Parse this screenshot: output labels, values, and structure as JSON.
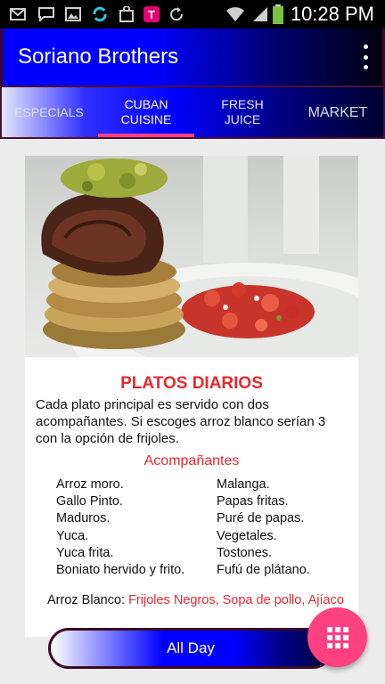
{
  "status_bar": {
    "icons": [
      "mail-icon",
      "chat-icon",
      "image-icon",
      "sync-app-icon",
      "bag-icon",
      "tmobile-icon",
      "refresh-icon",
      "wifi-icon",
      "signal-icon",
      "battery-icon"
    ],
    "time": "10:28 PM"
  },
  "app_bar": {
    "title": "Soriano Brothers",
    "menu_icon": "more-vert-icon"
  },
  "tabs": [
    {
      "label": "ESPECIALS",
      "selected": false
    },
    {
      "label": "CUBAN CUISINE",
      "selected": true
    },
    {
      "label": "FRESH JUICE",
      "selected": false
    },
    {
      "label": "MARKET",
      "selected": false
    }
  ],
  "colors": {
    "accent": "#ff4081",
    "heading_red": "#e8282f",
    "primary_blue": "#0000ff"
  },
  "card": {
    "title": "PLATOS DIARIOS",
    "description": "Cada plato principal es servido con dos acompañantes. Si escoges arroz blanco serían 3 con la opción de frijoles.",
    "sides_title": "Acompañantes",
    "sides_left": [
      "Arroz moro.",
      "Gallo Pinto.",
      "Maduros.",
      "Yuca.",
      "Yuca frita.",
      "Boniato hervido y frito."
    ],
    "sides_right": [
      "Malanga.",
      "Papas fritas.",
      "Puré de papas.",
      "Vegetales.",
      "Tostones.",
      "Fufú de plátano."
    ],
    "arroz_label": "Arroz Blanco: ",
    "arroz_options": "Frijoles Negros, Sopa de pollo, Ajíaco"
  },
  "bottom_button": {
    "label": "All Day"
  },
  "fab": {
    "icon": "apps-grid-icon"
  }
}
